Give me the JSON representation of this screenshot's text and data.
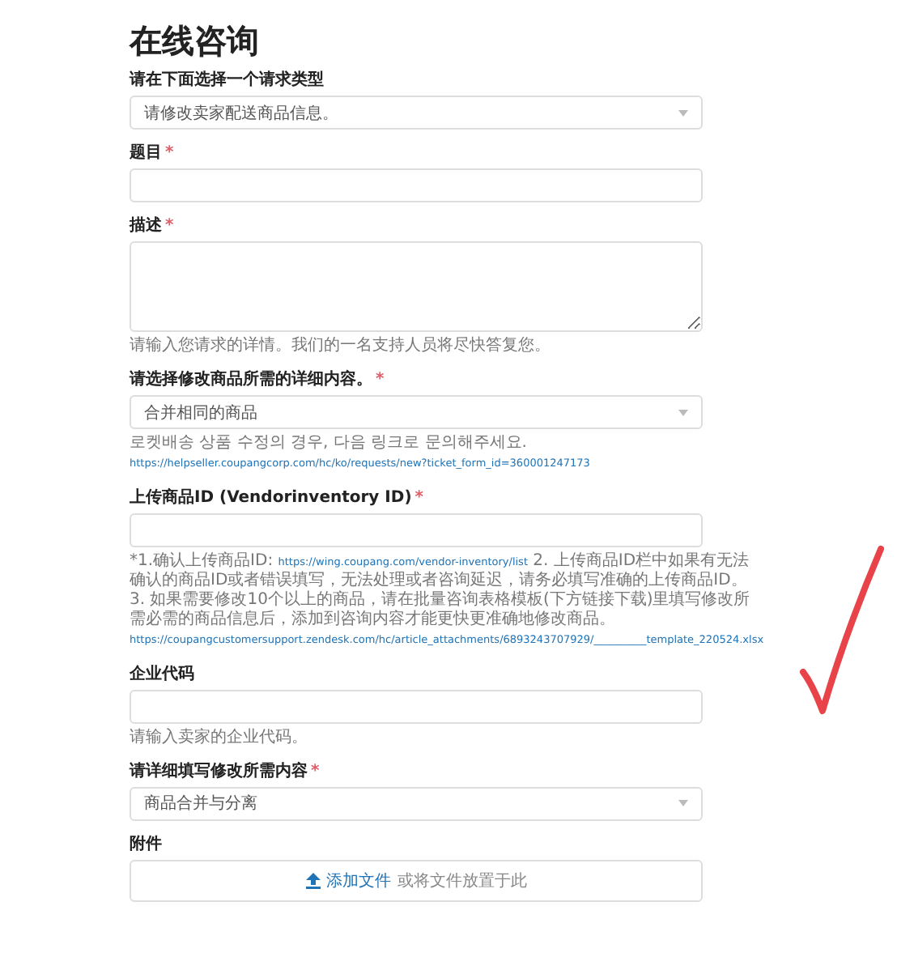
{
  "title": "在线咨询",
  "fields": [
    {
      "kind": "select",
      "label": "请在下面选择一个请求类型",
      "value": "请修改卖家配送商品信息。"
    },
    {
      "kind": "input",
      "label": "题目",
      "required_mark": "*"
    },
    {
      "kind": "textarea",
      "label": "描述",
      "required_mark": "*",
      "hint": [
        {
          "kind": "text",
          "text": "请输入您请求的详情。我们的一名支持人员将尽快答复您。"
        }
      ]
    },
    {
      "kind": "select",
      "label": "请选择修改商品所需的详细内容。",
      "required_mark": "*",
      "value": "合并相同的商品",
      "hint": [
        {
          "kind": "text",
          "text": "로켓배송 상품 수정의 경우, 다음 링크로 문의해주세요. "
        },
        {
          "kind": "link",
          "text": "https://helpseller.coupangcorp.com/hc/ko/requests/new?ticket_form_id=360001247173"
        }
      ]
    },
    {
      "kind": "input",
      "label": "上传商品ID (Vendorinventory ID)",
      "required_mark": "*",
      "hint": [
        {
          "kind": "text",
          "text": "*1.确认上传商品ID: "
        },
        {
          "kind": "link",
          "text": "https://wing.coupang.com/vendor-inventory/list"
        },
        {
          "kind": "text",
          "text": " 2. 上传商品ID栏中如果有无法确认的商品ID或者错误填写，无法处理或者咨询延迟，请务必填写准确的上传商品ID。 3. 如果需要修改10个以上的商品，请在批量咨询表格模板(下方链接下载)里填写修改所需必需的商品信息后，添加到咨询内容才能更快更准确地修改商品。 "
        },
        {
          "kind": "link",
          "text": "https://coupangcustomersupport.zendesk.com/hc/article_attachments/6893243707929/__________template_220524.xlsx"
        }
      ]
    },
    {
      "kind": "input",
      "label": "企业代码",
      "hint": [
        {
          "kind": "text",
          "text": "请输入卖家的企业代码。"
        }
      ]
    },
    {
      "kind": "select",
      "label": "请详细填写修改所需内容",
      "required_mark": "*",
      "value": "商品合并与分离"
    },
    {
      "kind": "file",
      "label": "附件",
      "action": "添加文件",
      "drop_text": "或将文件放置于此"
    }
  ]
}
